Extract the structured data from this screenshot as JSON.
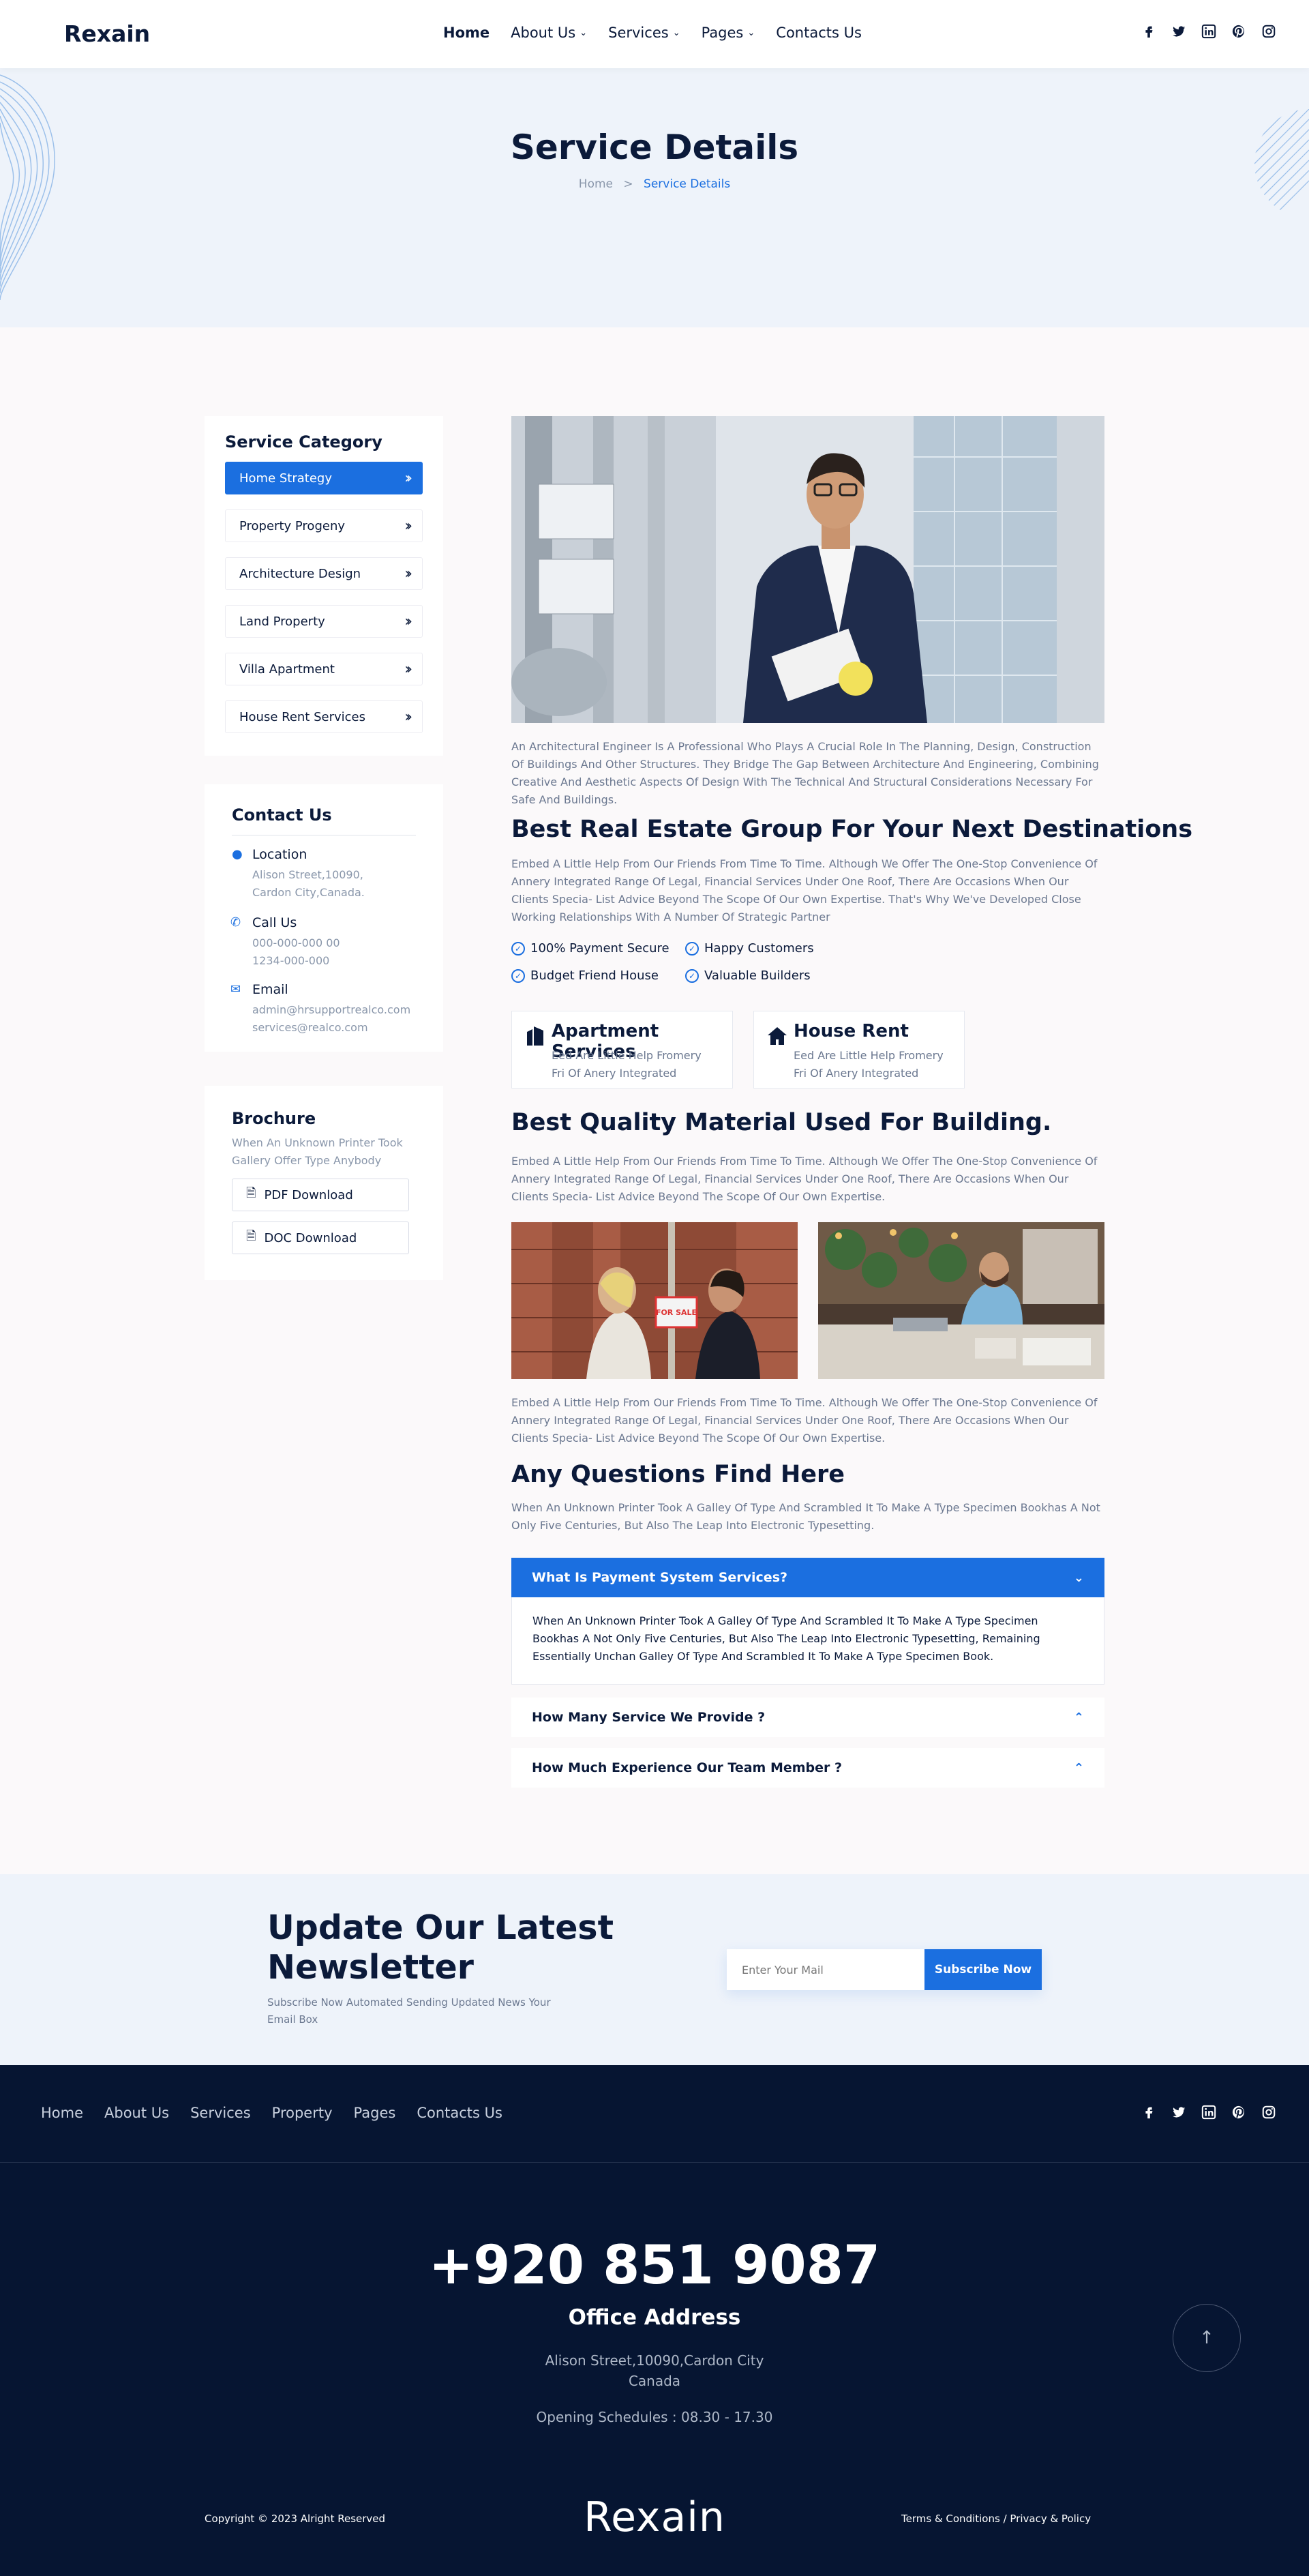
{
  "header": {
    "logo": "Rexain",
    "nav": [
      {
        "label": "Home",
        "dropdown": false,
        "active": true
      },
      {
        "label": "About Us",
        "dropdown": true
      },
      {
        "label": "Services",
        "dropdown": true
      },
      {
        "label": "Pages",
        "dropdown": true
      },
      {
        "label": "Contacts Us",
        "dropdown": false
      }
    ],
    "social_icons": [
      "facebook-icon",
      "twitter-icon",
      "linkedin-icon",
      "pinterest-icon",
      "instagram-icon"
    ]
  },
  "hero": {
    "title": "Service Details",
    "breadcrumb": {
      "home": "Home",
      "separator": ">",
      "current": "Service Details"
    }
  },
  "sidebar": {
    "category_title": "Service Category",
    "categories": [
      {
        "label": "Home Strategy",
        "active": true
      },
      {
        "label": "Property Progeny"
      },
      {
        "label": "Architecture Design"
      },
      {
        "label": "Land Property"
      },
      {
        "label": "Villa Apartment"
      },
      {
        "label": "House Rent Services"
      }
    ],
    "contact": {
      "title": "Contact Us",
      "location_label": "Location",
      "location_lines": [
        "Alison Street,10090,",
        "Cardon City,Canada."
      ],
      "call_label": "Call Us",
      "phones": [
        "000-000-000 00",
        "1234-000-000"
      ],
      "email_label": "Email",
      "emails": [
        "admin@hrsupportrealco.com",
        "services@realco.com"
      ]
    },
    "brochure": {
      "title": "Brochure",
      "text_lines": [
        "When An Unknown Printer Took",
        "Gallery Offer Type Anybody"
      ],
      "pdf_label": "PDF Download",
      "doc_label": "DOC Download"
    }
  },
  "content": {
    "intro": "An Architectural Engineer Is A Professional Who Plays A Crucial Role In The Planning, Design, Construction Of Buildings And Other Structures. They Bridge The Gap Between Architecture And Engineering, Combining Creative And Aesthetic Aspects Of Design With The Technical And Structural Considerations Necessary For Safe And  Buildings.",
    "heading1": "Best Real Estate Group For Your Next Destinations",
    "para1": "Embed A Little Help From Our Friends From Time To Time. Although We Offer The One-Stop Convenience Of Annery Integrated Range Of Legal, Financial Services Under One Roof, There Are Occasions When Our Clients Specia- List Advice Beyond The Scope Of Our Own Expertise. That's Why We've Developed Close Working Relationships With A Number Of Strategic Partner",
    "checks": [
      "100% Payment Secure",
      "Happy Customers",
      "Budget Friend House",
      "Valuable Builders"
    ],
    "services": [
      {
        "title": "Apartment Services",
        "lines": [
          "Eed Are Little Help Fromery",
          "Fri Of Anery Integrated"
        ]
      },
      {
        "title": "House Rent",
        "lines": [
          "Eed Are Little Help Fromery",
          "Fri Of Anery Integrated"
        ]
      }
    ],
    "heading2": "Best Quality Material Used For Building.",
    "para2": "Embed A Little Help From Our Friends From Time To Time. Although We Offer The One-Stop Convenience Of Annery Integrated Range Of Legal, Financial Services Under One Roof, There Are Occasions When Our Clients Specia- List Advice Beyond The Scope Of Our Own Expertise.",
    "para3": "Embed A Little Help From Our Friends From Time To Time. Although We Offer The One-Stop Convenience Of Annery Integrated Range Of Legal, Financial Services Under One Roof, There Are Occasions When Our Clients Specia- List Advice Beyond The Scope Of Our Own Expertise.",
    "photo_sign": "FOR SALE",
    "faq_title": "Any Questions Find Here",
    "faq_intro": "When An Unknown Printer Took A Galley Of Type And Scrambled It To Make A Type Specimen Bookhas A Not Only Five Centuries, But Also The Leap Into Electronic Typesetting.",
    "faqs": [
      {
        "q": "What Is Payment System Services?",
        "a": "When An Unknown Printer Took A Galley Of Type And Scrambled It To Make A Type Specimen Bookhas A Not Only Five Centuries, But Also The Leap Into Electronic Typesetting, Remaining Essentially Unchan Galley Of Type And Scrambled It To Make A Type Specimen Book.",
        "open": true
      },
      {
        "q": "How Many Service We Provide ?",
        "open": false
      },
      {
        "q": "How Much Experience Our Team Member ?",
        "open": false
      }
    ]
  },
  "newsletter": {
    "title_lines": [
      "Update Our Latest",
      "Newsletter"
    ],
    "subtitle_lines": [
      "Subscribe Now Automated Sending Updated News Your",
      "Email Box"
    ],
    "input_placeholder": "Enter Your Mail",
    "button": "Subscribe Now"
  },
  "footer": {
    "nav": [
      "Home",
      "About Us",
      "Services",
      "Property",
      "Pages",
      "Contacts Us"
    ],
    "phone": "+920 851 9087",
    "office_title": "Office Address",
    "address_lines": [
      "Alison Street,10090,Cardon City",
      "Canada"
    ],
    "schedule": "Opening Schedules : 08.30 - 17.30",
    "copyright": "Copyright © 2023 Alright Reserved",
    "logo": "Rexain",
    "terms": "Terms & Conditions / Privacy & Policy"
  },
  "colors": {
    "accent": "#1b6fe0",
    "navy": "#061532",
    "text_dark": "#0b1a3a",
    "muted": "#6b7890"
  }
}
